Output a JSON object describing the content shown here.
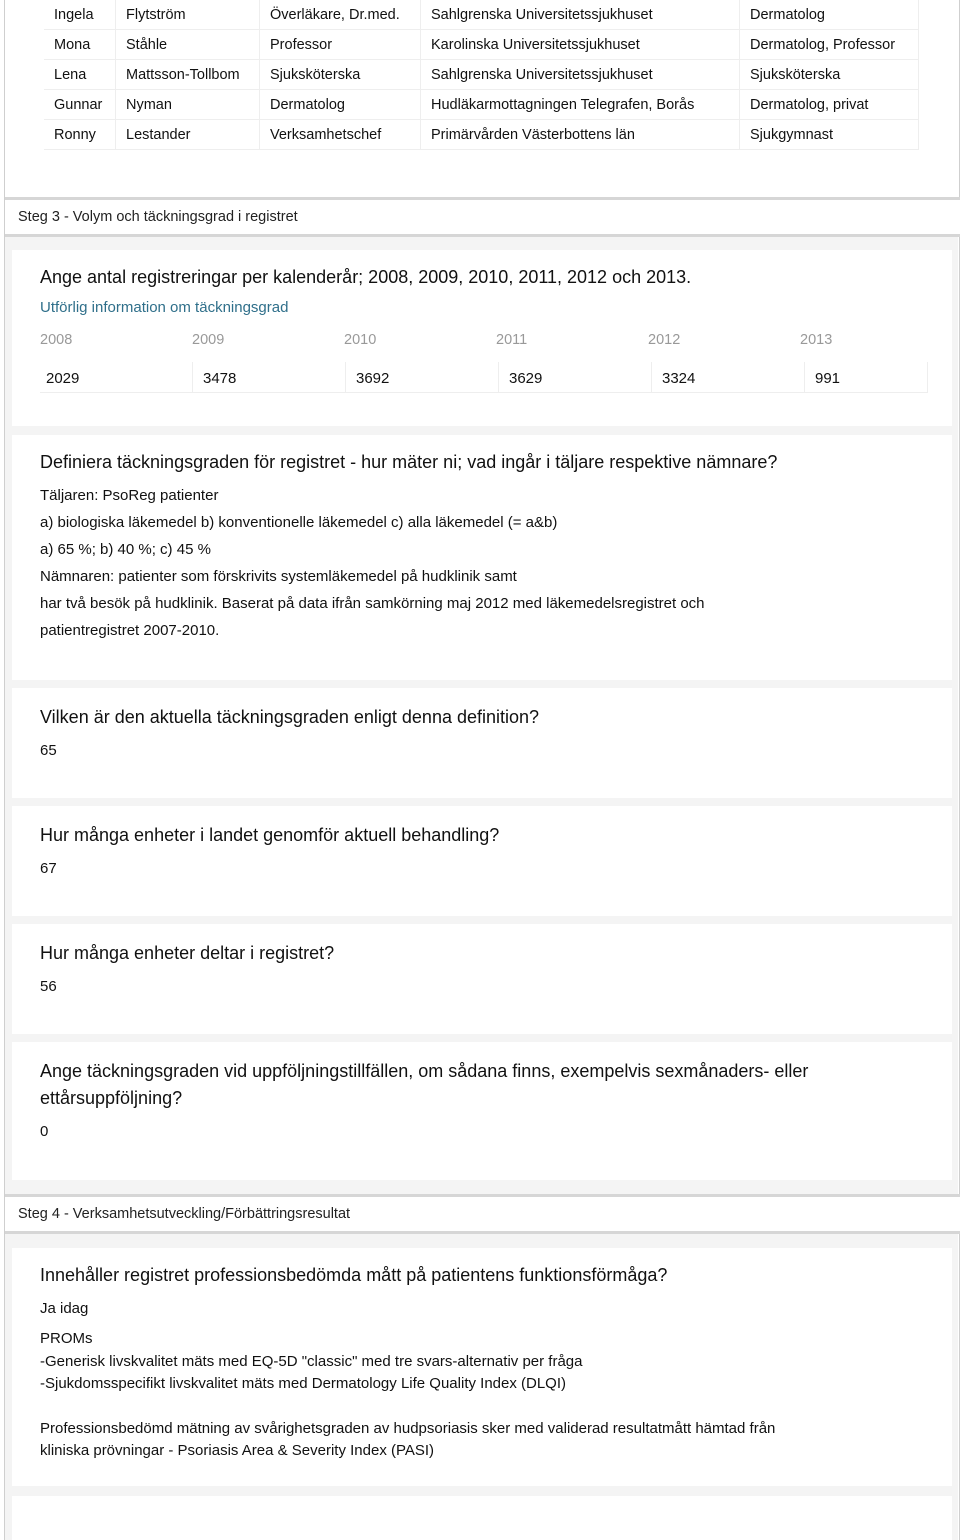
{
  "staff_table": {
    "rows": [
      [
        "Ingela",
        "Flytström",
        "Överläkare, Dr.med.",
        "Sahlgrenska Universitetssjukhuset",
        "Dermatolog"
      ],
      [
        "Mona",
        "Ståhle",
        "Professor",
        "Karolinska Universitetssjukhuset",
        "Dermatolog, Professor"
      ],
      [
        "Lena",
        "Mattsson-Tollbom",
        "Sjuksköterska",
        "Sahlgrenska Universitetssjukhuset",
        "Sjuksköterska"
      ],
      [
        "Gunnar",
        "Nyman",
        "Dermatolog",
        "Hudläkarmottagningen Telegrafen, Borås",
        "Dermatolog, privat"
      ],
      [
        "Ronny",
        "Lestander",
        "Verksamhetschef",
        "Primärvården Västerbottens län",
        "Sjukgymnast"
      ]
    ]
  },
  "step3": {
    "header": "Steg 3 - Volym och täckningsgrad i registret",
    "registrations": {
      "question": "Ange antal registreringar per kalenderår; 2008, 2009, 2010, 2011, 2012 och 2013.",
      "link": "Utförlig information om täckningsgrad",
      "years": [
        "2008",
        "2009",
        "2010",
        "2011",
        "2012",
        "2013"
      ],
      "values": [
        "2029",
        "3478",
        "3692",
        "3629",
        "3324",
        "991"
      ]
    },
    "definition": {
      "question": "Definiera täckningsgraden för registret - hur mäter ni; vad ingår i täljare respektive nämnare?",
      "lines": [
        "Täljaren: PsoReg patienter",
        "a) biologiska läkemedel b) konventionelle läkemedel c) alla läkemedel (= a&b)",
        "a) 65 %; b) 40 %; c) 45 %",
        "Nämnaren: patienter som förskrivits systemläkemedel på hudklinik samt",
        "har två besök på hudklinik. Baserat på data ifrån samkörning maj 2012 med läkemedelsregistret och",
        "patientregistret 2007-2010."
      ]
    },
    "current_coverage": {
      "question": "Vilken är den aktuella täckningsgraden enligt denna definition?",
      "answer": "65"
    },
    "units_treatment": {
      "question": "Hur många enheter i landet genomför aktuell behandling?",
      "answer": "67"
    },
    "units_registry": {
      "question": "Hur många enheter deltar i registret?",
      "answer": "56"
    },
    "followup": {
      "question_line1": "Ange täckningsgraden vid uppföljningstillfällen, om sådana finns, exempelvis sexmånaders- eller",
      "question_line2": "ettårsuppföljning?",
      "answer": "0"
    }
  },
  "step4": {
    "header": "Steg 4 - Verksamhetsutveckling/Förbättringsresultat",
    "function_measures": {
      "question": "Innehåller registret professionsbedömda mått på patientens funktionsförmåga?",
      "answer_first": "Ja idag",
      "proms_lines": [
        "PROMs",
        "-Generisk livskvalitet mäts med EQ-5D \"classic\" med tre svars-alternativ per fråga",
        "-Sjukdomsspecifikt livskvalitet mäts med Dermatology Life Quality Index (DLQI)"
      ],
      "pasi_lines": [
        "Professionsbedömd mätning av svårighetsgraden av hudpsoriasis sker med validerad resultatmått hämtad från",
        "kliniska prövningar - Psoriasis Area & Severity Index (PASI)"
      ]
    }
  }
}
